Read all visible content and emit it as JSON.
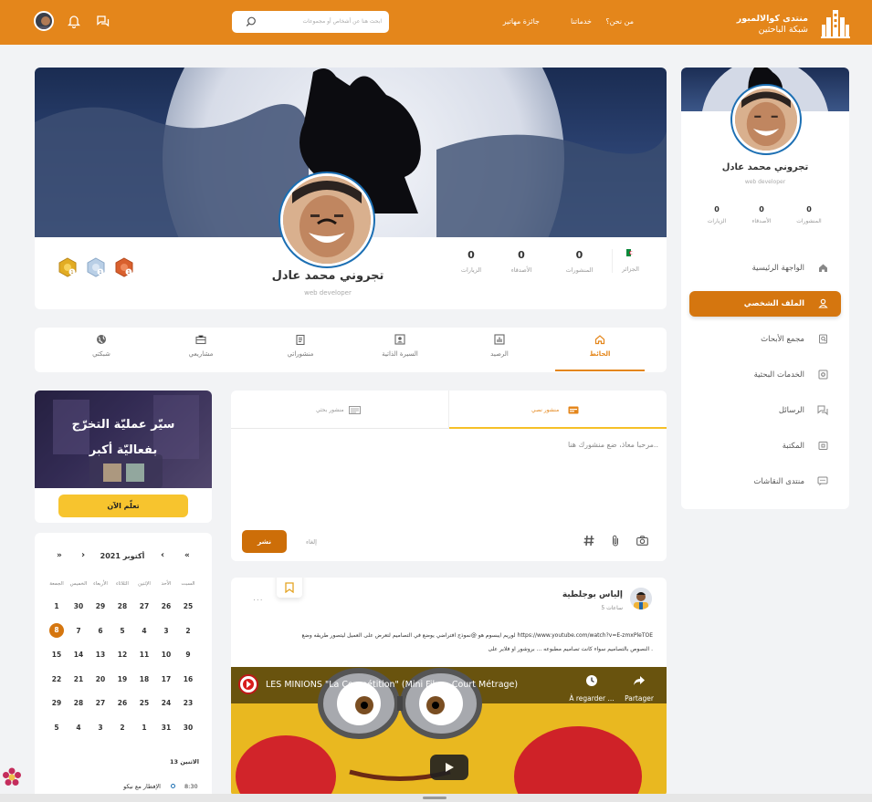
{
  "header": {
    "brand_line1": "منتدى كوالالمبور",
    "brand_line2": "شبكة الباحثين",
    "nav": [
      "من نحن؟",
      "خدماتنا",
      "جائزة مهاتير"
    ],
    "search_placeholder": "ابحث هنا عن أشخاص أو مجموعات"
  },
  "profile": {
    "name": "تجروني محمد عادل",
    "role": "web developer",
    "stats": [
      {
        "value": "0",
        "label": "الزيارات"
      },
      {
        "value": "0",
        "label": "الأصدقاء"
      },
      {
        "value": "0",
        "label": "المنشورات"
      }
    ],
    "country": "الجزائر",
    "badges": [
      "1",
      "1",
      "1"
    ]
  },
  "tabs": [
    "الحائط",
    "الرصيد",
    "السيرة الذاتية",
    "منشوراتي",
    "مشاريعي",
    "شبكتي"
  ],
  "sidebar": {
    "name": "تجروني محمد عادل",
    "role": "web developer",
    "stats": [
      {
        "value": "0",
        "label": "المنشورات"
      },
      {
        "value": "0",
        "label": "الأصدقاء"
      },
      {
        "value": "0",
        "label": "الزيارات"
      }
    ],
    "nav": [
      {
        "label": "الواجهة الرئيسية",
        "icon": "home-icon"
      },
      {
        "label": "الملف الشخصي",
        "icon": "user-icon",
        "active": true
      },
      {
        "label": "مجمع الأبحاث",
        "icon": "search-doc-icon"
      },
      {
        "label": "الخدمات البحثية",
        "icon": "gear-icon"
      },
      {
        "label": "الرسائل",
        "icon": "messages-icon"
      },
      {
        "label": "المكتبة",
        "icon": "library-icon"
      },
      {
        "label": "منتدى النقاشات",
        "icon": "forum-icon"
      }
    ]
  },
  "composer": {
    "tab_text": "منشور نصي",
    "tab_research": "منشور بحثي",
    "placeholder": "مرحبا معاذ، ضع منشورك هنا..",
    "cancel": "إلغاء",
    "publish": "نشر"
  },
  "promo": {
    "line1": "سيّر عمليّة التخرّج",
    "line2": "بفعاليّة أكبر",
    "button": "تعلّم الآن"
  },
  "calendar": {
    "month": "أكتوبر 2021",
    "weekdays": [
      "السبت",
      "الأحد",
      "الإثنين",
      "الثلاثاء",
      "الأربعاء",
      "الخميس",
      "الجمعة"
    ],
    "weeks": [
      [
        "25",
        "26",
        "27",
        "28",
        "29",
        "30",
        "1"
      ],
      [
        "2",
        "3",
        "4",
        "5",
        "6",
        "7",
        "8"
      ],
      [
        "9",
        "10",
        "11",
        "12",
        "13",
        "14",
        "15"
      ],
      [
        "16",
        "17",
        "18",
        "19",
        "20",
        "21",
        "22"
      ],
      [
        "23",
        "24",
        "25",
        "26",
        "27",
        "28",
        "29"
      ],
      [
        "30",
        "31",
        "1",
        "2",
        "3",
        "4",
        "5"
      ]
    ],
    "today": "8",
    "agenda_date": "الاثنين 13",
    "event_time": "8:30",
    "event_title": "الإفطار مع نيكو",
    "nav_prev2": "«",
    "nav_prev": "‹",
    "nav_next": "›",
    "nav_next2": "»"
  },
  "post": {
    "author": "إلياس بوجلطية",
    "time": "5 ساعات",
    "more": "...",
    "text_line1": "https://www.youtube.com/watch?v=E-zmxPleTOE لوريم ايبسوم هو @نموذج افتراضي يوضع في التصاميم لتعرض على العميل ليتصور طريقه وضع",
    "text_line2": "النصوص بالتصاميم سواء كانت تصاميم مطبوعه ... بروشور او فلاير على .",
    "video_title": "LES MINIONS \"La Compétition\" (Mini Film - Court Métrage)",
    "video_watch_later": "À regarder ...",
    "video_share": "Partager"
  },
  "colors": {
    "accent": "#e4861b",
    "accent_dark": "#c96d0a",
    "yellow": "#f6c028"
  }
}
